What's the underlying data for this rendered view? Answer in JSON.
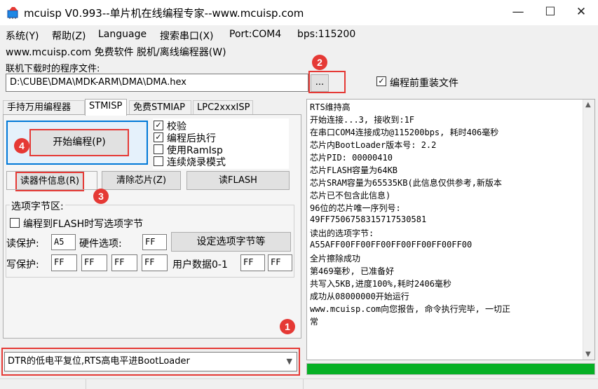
{
  "window": {
    "title": "mcuisp V0.993--单片机在线编程专家--www.mcuisp.com",
    "minimize": "—",
    "maximize": "☐",
    "close": "✕"
  },
  "menu": [
    "系统(Y)",
    "帮助(Z)",
    "Language",
    "搜索串口(X)",
    "Port:COM4",
    "bps:115200"
  ],
  "submenu": "www.mcuisp.com 免费软件 脱机/离线编程器(W)",
  "file_section": {
    "label": "联机下载时的程序文件:",
    "path": "D:\\CUBE\\DMA\\MDK-ARM\\DMA\\DMA.hex",
    "browse_label": "...",
    "reload_label": "编程前重装文件",
    "reload_checked": true
  },
  "tabs": [
    {
      "label": "手持万用编程器",
      "active": false
    },
    {
      "label": "STMISP",
      "active": true
    },
    {
      "label": "免费STMIAP",
      "active": false
    },
    {
      "label": "LPC2xxxISP",
      "active": false
    }
  ],
  "stmisp": {
    "start_label": "开始编程(P)",
    "options": [
      {
        "label": "校验",
        "checked": true
      },
      {
        "label": "编程后执行",
        "checked": true
      },
      {
        "label": "使用RamIsp",
        "checked": false
      },
      {
        "label": "连续烧录模式",
        "checked": false
      }
    ],
    "read_info_label": "读器件信息(R)",
    "erase_label": "清除芯片(Z)",
    "read_flash_label": "读FLASH",
    "option_bytes": {
      "title": "选项字节区:",
      "write_to_flash_label": "编程到FLASH时写选项字节",
      "write_to_flash_checked": false,
      "read_protect_label": "读保护:",
      "read_protect_value": "A5",
      "hardware_label": "硬件选项:",
      "hardware_value": "FF",
      "set_label": "设定选项字节等",
      "write_protect_label": "写保护:",
      "write_protect_values": [
        "FF",
        "FF",
        "FF",
        "FF"
      ],
      "user_data_label": "用户数据0-1",
      "user_data_values": [
        "FF",
        "FF"
      ]
    }
  },
  "reset_mode": "DTR的低电平复位,RTS高电平进BootLoader",
  "log": [
    "RTS维持高",
    "开始连接...3, 接收到:1F",
    "在串口COM4连接成功@115200bps, 耗时406毫秒",
    "芯片内BootLoader版本号: 2.2",
    "芯片PID: 00000410",
    "芯片FLASH容量为64KB",
    "芯片SRAM容量为65535KB(此信息仅供参考,新版本",
    "芯片已不包含此信息)",
    "96位的芯片唯一序列号:",
    "49FF7506758315717530581",
    "读出的选项字节:",
    "A55AFF00FF00FF00FF00FF00FF00FF00",
    "全片擦除成功",
    "第469毫秒, 已准备好",
    "共写入5KB,进度100%,耗时2406毫秒",
    "成功从08000000开始运行",
    "www.mcuisp.com向您报告, 命令执行完毕, 一切正",
    "常"
  ],
  "progress": 1.0,
  "annotations": [
    "1",
    "2",
    "3",
    "4"
  ],
  "colors": {
    "highlight": "#e53935",
    "progress": "#06b025",
    "window_bg": "#f0f0f0"
  },
  "icons": {
    "app": "chip-icon",
    "dropdown": "chevron-down-icon",
    "scroll_up": "chevron-up-icon",
    "scroll_down": "chevron-down-icon"
  }
}
